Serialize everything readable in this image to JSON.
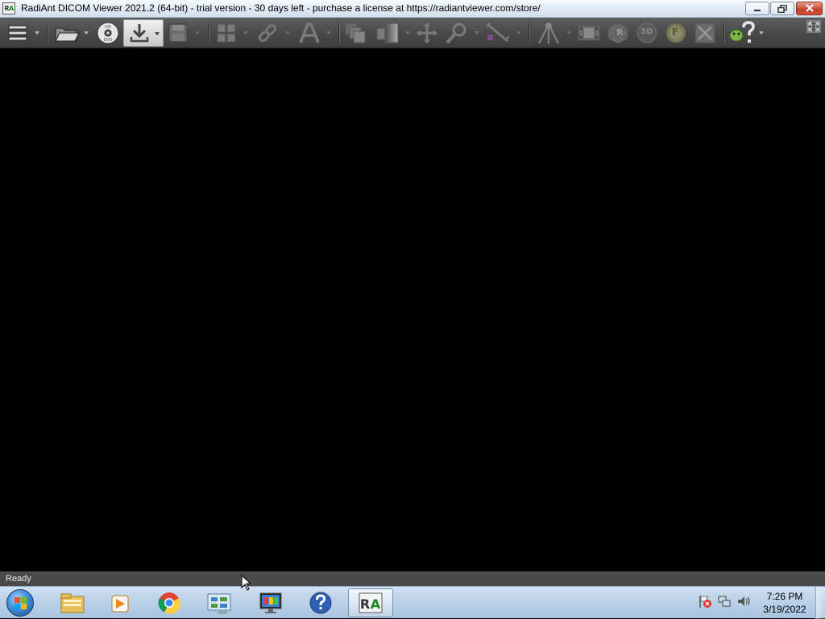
{
  "window": {
    "title": "RadiAnt DICOM Viewer 2021.2 (64-bit) - trial version - 30 days left - purchase a license at https://radiantviewer.com/store/",
    "app_icon_letters": [
      "R",
      "A"
    ]
  },
  "toolbar": {
    "buttons": [
      {
        "name": "menu-icon",
        "enabled": true,
        "dropdown": true
      },
      {
        "name": "open-folder-icon",
        "enabled": true,
        "dropdown": true
      },
      {
        "name": "cd-dvd-icon",
        "enabled": true,
        "dropdown": false
      },
      {
        "name": "download-icon",
        "enabled": true,
        "dropdown": true,
        "pressed": true
      },
      {
        "name": "save-icon",
        "enabled": false,
        "dropdown": true
      },
      {
        "name": "layout-grid-icon",
        "enabled": false,
        "dropdown": true
      },
      {
        "name": "link-icon",
        "enabled": false,
        "dropdown": true
      },
      {
        "name": "annotation-text-icon",
        "enabled": false,
        "dropdown": true
      },
      {
        "name": "stack-images-icon",
        "enabled": false,
        "dropdown": false
      },
      {
        "name": "window-level-icon",
        "enabled": false,
        "dropdown": true
      },
      {
        "name": "pan-icon",
        "enabled": false,
        "dropdown": false
      },
      {
        "name": "zoom-icon",
        "enabled": false,
        "dropdown": true
      },
      {
        "name": "measure-ruler-icon",
        "enabled": false,
        "dropdown": true
      },
      {
        "name": "reference-lines-icon",
        "enabled": false,
        "dropdown": true
      },
      {
        "name": "cine-film-icon",
        "enabled": false,
        "dropdown": false
      },
      {
        "name": "mpr-icon",
        "enabled": false,
        "dropdown": false
      },
      {
        "name": "3d-volume-icon",
        "enabled": false,
        "dropdown": false
      },
      {
        "name": "fusion-icon",
        "enabled": false,
        "dropdown": false
      },
      {
        "name": "close-study-icon",
        "enabled": false,
        "dropdown": false
      },
      {
        "name": "help-icon",
        "enabled": true,
        "dropdown": true
      },
      {
        "name": "fullscreen-icon",
        "enabled": true,
        "dropdown": false
      }
    ],
    "mpr_letter": "R",
    "volume_label": "3D",
    "fusion_letter": "F"
  },
  "status": {
    "text": "Ready"
  },
  "taskbar": {
    "items": [
      {
        "name": "start-button"
      },
      {
        "name": "file-explorer-icon"
      },
      {
        "name": "media-player-icon"
      },
      {
        "name": "chrome-icon"
      },
      {
        "name": "control-panel-icon"
      },
      {
        "name": "display-monitor-icon"
      },
      {
        "name": "help-support-icon"
      },
      {
        "name": "radiant-taskbar-icon",
        "active": true
      }
    ],
    "tray": [
      "action-center-flag-icon",
      "network-icon",
      "volume-icon"
    ],
    "clock": {
      "time": "7:26 PM",
      "date": "3/19/2022"
    }
  },
  "colors": {
    "toolbar_bg": "#4a4a4a",
    "viewer_bg": "#000000",
    "statusbar_bg": "#4a4a4a",
    "taskbar_bg": "#b9d0e8",
    "close_button": "#c2402a",
    "radiant_green": "#1a8a1a"
  }
}
